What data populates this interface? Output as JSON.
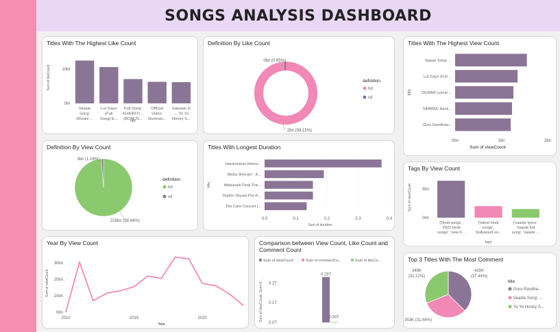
{
  "header": {
    "title": "SONGS ANALYSIS DASHBOARD"
  },
  "colors": {
    "purple": "#8b7596",
    "pink": "#f188b6",
    "green": "#8bc96f",
    "pinkStrip": "#f48fb1",
    "header": "#e9d8f5"
  },
  "cards": {
    "like_bar": {
      "title": "Titles With The Highest Like Count"
    },
    "def_like": {
      "title": "Definition By Like Count"
    },
    "view_hbar": {
      "title": "Titles With The Highest View Count"
    },
    "def_view": {
      "title": "Definition By View Count"
    },
    "duration": {
      "title": "Titles With Longest Duration"
    },
    "tags": {
      "title": "Tags By View Count"
    },
    "year": {
      "title": "Year By View Count"
    },
    "comparison": {
      "title": "Comparison between View Count, Like Count and Comment Count"
    },
    "top3": {
      "title": "Top 3 Titles With The Most Comment"
    }
  },
  "chart_data": [
    {
      "id": "like_bar",
      "type": "bar",
      "title": "Titles With The Highest Like Count",
      "xlabel": "title",
      "ylabel": "Sum of likeCount",
      "ylim": [
        0,
        15
      ],
      "yticks": [
        {
          "v": 0,
          "label": "0M"
        },
        {
          "v": 10,
          "label": "10M"
        }
      ],
      "categories": [
        [
          "Vaaste",
          "Song:",
          "Dhvani ..."
        ],
        [
          "Lut Gaye",
          "(Full",
          "Song) E..."
        ],
        [
          "Full Song:",
          "KHAIRIYI...",
          "(BONUS..."
        ],
        [
          "Official",
          "Video:",
          "Humnav..."
        ],
        [
          "Saiyaan Ji",
          "← Yo Yo",
          "Honey S..."
        ]
      ],
      "values": [
        12.5,
        10.6,
        7.1,
        6.3,
        6.2
      ]
    },
    {
      "id": "def_like",
      "type": "pie",
      "title": "Definition By Like Count",
      "legend_title": "definition",
      "legend": [
        "hd",
        "sd"
      ],
      "slices": [
        {
          "name": "hd",
          "value": 99.15,
          "label": "2bn (99.15%)"
        },
        {
          "name": "sd",
          "value": 0.85,
          "label": "0bn (0.85%)"
        }
      ]
    },
    {
      "id": "view_hbar",
      "type": "bar",
      "title": "Titles With The Highest View Count",
      "xlabel": "Sum of viewCount",
      "ylabel": "title",
      "xlim": [
        0,
        2
      ],
      "xticks": [
        {
          "v": 0,
          "label": "0bn"
        },
        {
          "v": 1,
          "label": "1bn"
        },
        {
          "v": 2,
          "label": "2bn"
        }
      ],
      "categories": [
        "Vaaste Song: ...",
        "Lut Gaye (Full ...",
        "DILBAR Lyrical ...",
        "SIMMBA: Aank...",
        "Guru Randhaw..."
      ],
      "values": [
        1.55,
        1.35,
        1.26,
        1.23,
        1.2
      ]
    },
    {
      "id": "def_view",
      "type": "pie",
      "title": "Definition By View Count",
      "legend_title": "definition",
      "legend": [
        "hd",
        "sd"
      ],
      "slices": [
        {
          "name": "hd",
          "value": 98.84,
          "label": "228bn (98.84%)"
        },
        {
          "name": "sd",
          "value": 1.16,
          "label": "3bn (1.16%)"
        }
      ]
    },
    {
      "id": "duration",
      "type": "bar",
      "title": "Titles With Longest Duration",
      "xlabel": "Sum of duration",
      "ylabel": "title",
      "xlim": [
        0,
        0.4
      ],
      "xticks": [
        {
          "v": 0,
          "label": "0.0"
        },
        {
          "v": 0.1,
          "label": "0.1"
        },
        {
          "v": 0.2,
          "label": "0.2"
        },
        {
          "v": 0.3,
          "label": "0.3"
        },
        {
          "v": 0.4,
          "label": "0.4"
        }
      ],
      "categories": [
        "Harmonious Himes...",
        "Maha Shivratri · A...",
        "Adipurush Final Trai...",
        "Radhe Shyam Pre R...",
        "The Care Concert |..."
      ],
      "values": [
        0.375,
        0.19,
        0.155,
        0.155,
        0.135
      ]
    },
    {
      "id": "tags",
      "type": "bar",
      "title": "Tags By View Count",
      "xlabel": "tags",
      "ylabel": "Sum of viewCount",
      "ylim": [
        0,
        7
      ],
      "yticks": [
        {
          "v": 0,
          "label": "0bn"
        },
        {
          "v": 5,
          "label": "5bn"
        }
      ],
      "categories": [
        [
          "['hindi songs',",
          "'2021 hindi",
          "songs', 'new h..."
        ],
        [
          "['latest hindi",
          "songs',",
          "'bollywood so..."
        ],
        [
          "['vaaste lyrics',",
          "'vaaste full",
          "song', 'vaaste ..."
        ]
      ],
      "values": [
        6.4,
        2.0,
        1.5
      ]
    },
    {
      "id": "year",
      "type": "line",
      "title": "Year By View Count",
      "xlabel": "Year",
      "ylabel": "Sum of viewCount",
      "xlim": [
        2010,
        2023
      ],
      "ylim": [
        0,
        35
      ],
      "xticks": [
        {
          "v": 2010,
          "label": "2010"
        },
        {
          "v": 2015,
          "label": "2015"
        },
        {
          "v": 2020,
          "label": "2020"
        }
      ],
      "yticks": [
        {
          "v": 0,
          "label": "0bn"
        },
        {
          "v": 10,
          "label": "10bn"
        },
        {
          "v": 20,
          "label": "20bn"
        },
        {
          "v": 30,
          "label": "30bn"
        }
      ],
      "x": [
        2010,
        2011,
        2012,
        2013,
        2014,
        2015,
        2016,
        2017,
        2018,
        2019,
        2020,
        2021,
        2022,
        2023
      ],
      "y": [
        0,
        30.5,
        7,
        11.5,
        13,
        15.5,
        22,
        20.5,
        33.5,
        32.5,
        17.5,
        16,
        11,
        4
      ]
    },
    {
      "id": "comparison",
      "type": "bar",
      "title": "Comparison between View Count, Like Count and Comment Count",
      "ylabel": "Sum of viewCount, Sum of ...",
      "ylim": [
        0,
        0.26
      ],
      "yticks": [
        {
          "v": 0,
          "label": "0.0T"
        },
        {
          "v": 0.1,
          "label": "0.1T"
        },
        {
          "v": 0.2,
          "label": "0.2T"
        }
      ],
      "legend": [
        "Sum of viewCount",
        "Sum of commentCo...",
        "Sum of likeCo..."
      ],
      "series": [
        {
          "name": "Sum of viewCount",
          "values": [
            0.23
          ],
          "label": "0.23T"
        },
        {
          "name": "Sum of likeCo...",
          "values": [
            0.002
          ],
          "label": "0.00T"
        }
      ]
    },
    {
      "id": "top3",
      "type": "pie",
      "title": "Top 3 Titles With The Most Comment",
      "legend_title": "title",
      "legend": [
        "Guru Randha...",
        "Vaaste Song: ...",
        "Yo Yo Honey S..."
      ],
      "slices": [
        {
          "name": "Guru Randha...",
          "value": 37.44,
          "label_top": "420K",
          "label_bot": "(37.44%)"
        },
        {
          "name": "Vaaste Song: ...",
          "value": 31.44,
          "label_top": "353K",
          "label_bot": "(31.44%)"
        },
        {
          "name": "Yo Yo Honey S...",
          "value": 31.12,
          "label_top": "349K",
          "label_bot": "(31.12%)"
        }
      ]
    }
  ]
}
